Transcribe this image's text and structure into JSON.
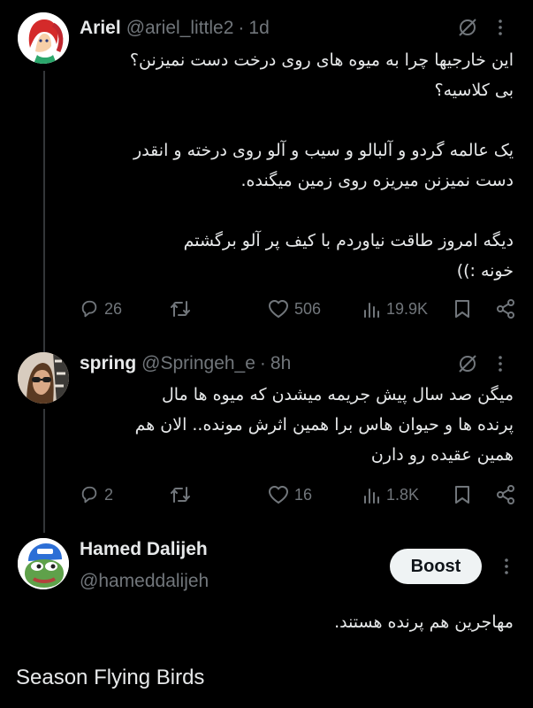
{
  "colors": {
    "background": "#000000",
    "text": "#e7e9ea",
    "muted": "#71767b",
    "thread_line": "#333639",
    "boost_bg": "#eff3f4"
  },
  "posts": [
    {
      "display_name": "Ariel",
      "handle": "@ariel_little2",
      "separator": "·",
      "time": "1d",
      "text": "این خارجیها چرا به میوه های روی درخت دست نمیزنن؟\nبی کلاسیه؟\n\nیک عالمه گردو و آلبالو و سیب و آلو روی درخته و انقدر\nدست نمیزنن میریزه روی زمین میگنده.\n\nدیگه امروز طاقت نیاوردم با کیف پر آلو برگشتم\nخونه :))",
      "replies": "26",
      "reposts": "",
      "likes": "506",
      "views": "19.9K",
      "icons": [
        "grok-icon",
        "more-icon",
        "reply-icon",
        "repost-icon",
        "like-icon",
        "views-icon",
        "bookmark-icon",
        "share-icon"
      ]
    },
    {
      "display_name": "spring",
      "handle": "@Springeh_e",
      "separator": "·",
      "time": "8h",
      "text": "میگن صد سال پیش جریمه میشدن که میوه ها مال\nپرنده ها و حیوان هاس برا همین اثرش مونده.. الان هم\nهمین عقیده رو دارن",
      "replies": "2",
      "reposts": "",
      "likes": "16",
      "views": "1.8K",
      "icons": [
        "grok-icon",
        "more-icon",
        "reply-icon",
        "repost-icon",
        "like-icon",
        "views-icon",
        "bookmark-icon",
        "share-icon"
      ]
    },
    {
      "display_name": "Hamed Dalijeh",
      "handle": "@hameddalijeh",
      "boost_label": "Boost",
      "text": "مهاجرین هم پرنده هستند.",
      "icons": [
        "more-icon"
      ]
    }
  ],
  "caption": "Season Flying Birds"
}
